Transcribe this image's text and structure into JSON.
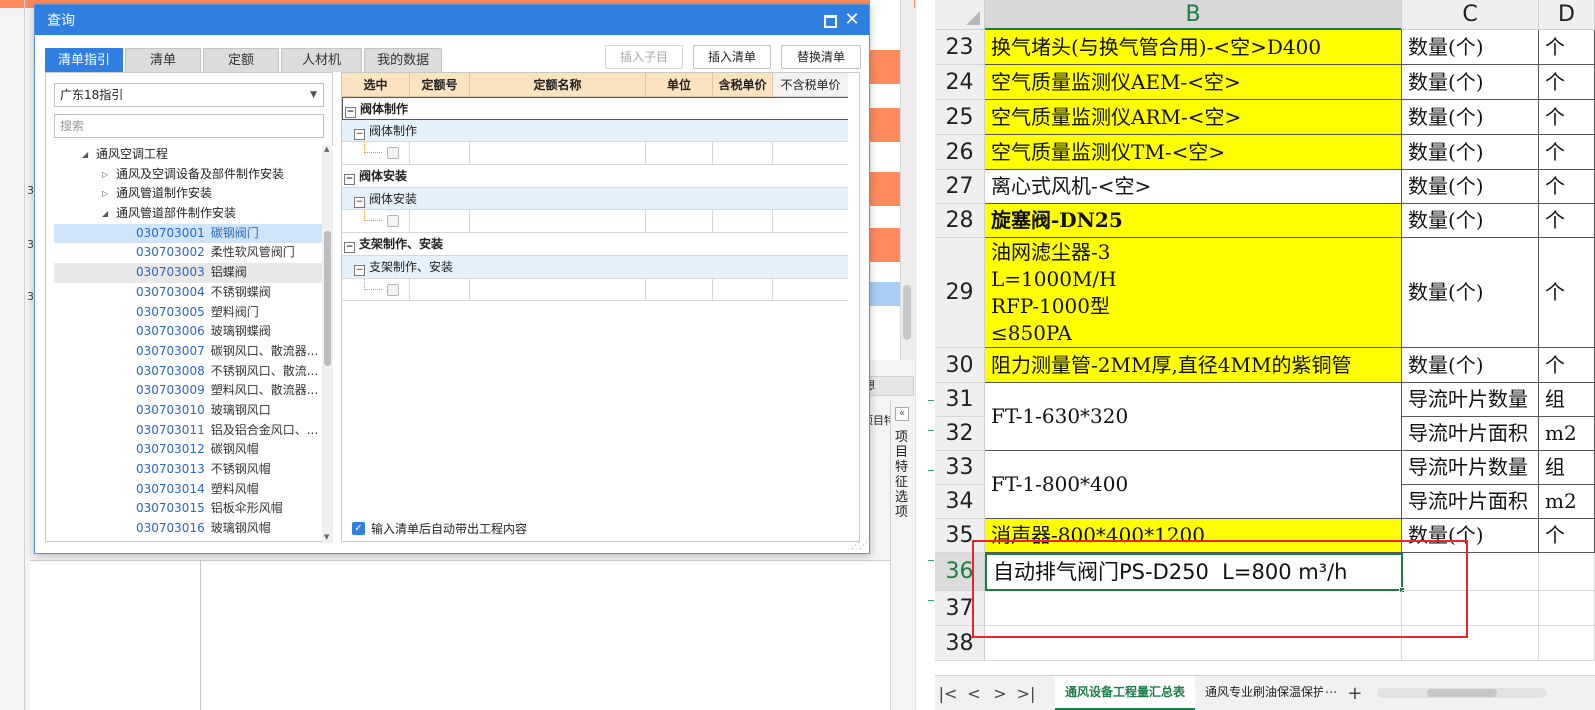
{
  "dialog": {
    "title": "查询",
    "tabs": [
      {
        "label": "清单指引",
        "active": true
      },
      {
        "label": "清单",
        "active": false
      },
      {
        "label": "定额",
        "active": false
      },
      {
        "label": "人材机",
        "active": false
      },
      {
        "label": "我的数据",
        "active": false
      }
    ],
    "buttons": {
      "insert_child": "插入子目",
      "insert_list": "插入清单(I)",
      "replace_list": "替换清单(R)"
    },
    "region_select": "广东18指引",
    "search_placeholder": "搜索",
    "tree": {
      "root": "通风空调工程",
      "groups": [
        "通风及空调设备及部件制作安装",
        "通风管道制作安装",
        "通风管道部件制作安装"
      ],
      "items": [
        {
          "code": "030703001",
          "name": "碳钢阀门"
        },
        {
          "code": "030703002",
          "name": "柔性软风管阀门"
        },
        {
          "code": "030703003",
          "name": "铝蝶阀"
        },
        {
          "code": "030703004",
          "name": "不锈钢蝶阀"
        },
        {
          "code": "030703005",
          "name": "塑料阀门"
        },
        {
          "code": "030703006",
          "name": "玻璃钢蝶阀"
        },
        {
          "code": "030703007",
          "name": "碳钢风口、散流器..."
        },
        {
          "code": "030703008",
          "name": "不锈钢风口、散流..."
        },
        {
          "code": "030703009",
          "name": "塑料风口、散流器..."
        },
        {
          "code": "030703010",
          "name": "玻璃钢风口"
        },
        {
          "code": "030703011",
          "name": "铝及铝合金风口、..."
        },
        {
          "code": "030703012",
          "name": "碳钢风帽"
        },
        {
          "code": "030703013",
          "name": "不锈钢风帽"
        },
        {
          "code": "030703014",
          "name": "塑料风帽"
        },
        {
          "code": "030703015",
          "name": "铝板伞形风帽"
        },
        {
          "code": "030703016",
          "name": "玻璃钢风帽"
        }
      ]
    },
    "grid": {
      "headers": [
        "选中",
        "定额号",
        "定额名称",
        "单位",
        "含税单价",
        "不含税单价"
      ],
      "groups": [
        {
          "name": "阀体制作",
          "sub": "阀体制作"
        },
        {
          "name": "阀体安装",
          "sub": "阀体安装"
        },
        {
          "name": "支架制作、安装",
          "sub": "支架制作、安装"
        }
      ]
    },
    "auto_bring_label": "输入清单后自动带出工程内容"
  },
  "background_app": {
    "side_panel_label": "项目特征选项",
    "tab_fragment": "想",
    "tab_fragment2": "项目特",
    "left_row_numbers": [
      "3",
      "3",
      "3"
    ]
  },
  "sheet": {
    "columns": [
      "B",
      "C",
      "D"
    ],
    "rows": [
      {
        "num": "23",
        "b": "换气堵头(与换气管合用)-<空>D400",
        "c": "数量(个)",
        "d": "个",
        "yellow": true
      },
      {
        "num": "24",
        "b": "空气质量监测仪AEM-<空>",
        "c": "数量(个)",
        "d": "个",
        "yellow": true
      },
      {
        "num": "25",
        "b": "空气质量监测仪ARM-<空>",
        "c": "数量(个)",
        "d": "个",
        "yellow": true
      },
      {
        "num": "26",
        "b": "空气质量监测仪TM-<空>",
        "c": "数量(个)",
        "d": "个",
        "yellow": true
      },
      {
        "num": "27",
        "b": "离心式风机-<空>",
        "c": "数量(个)",
        "d": "个",
        "yellow": false
      },
      {
        "num": "28",
        "b": "旋塞阀-DN25",
        "c": "数量(个)",
        "d": "个",
        "yellow": true
      },
      {
        "num": "29",
        "b": "油网滤尘器-3\nL=1000M/H\nRFP-1000型\n≤850PA",
        "c": "数量(个)",
        "d": "个",
        "yellow": true
      },
      {
        "num": "30",
        "b": "阻力测量管-2MM厚,直径4MM的紫铜管",
        "c": "数量(个)",
        "d": "个",
        "yellow": true
      },
      {
        "num": "31",
        "b": "FT-1-630*320",
        "c": "导流叶片数量",
        "d": "组",
        "yellow": false
      },
      {
        "num": "32",
        "b": "",
        "c": "导流叶片面积",
        "d": "m2",
        "yellow": false
      },
      {
        "num": "33",
        "b": "FT-1-800*400",
        "c": "导流叶片数量",
        "d": "组",
        "yellow": false
      },
      {
        "num": "34",
        "b": "",
        "c": "导流叶片面积",
        "d": "m2",
        "yellow": false
      },
      {
        "num": "35",
        "b": "消声器-800*400*1200",
        "c": "数量(个)",
        "d": "个",
        "yellow": true
      },
      {
        "num": "36",
        "b": "自动排气阀门PS-D250  L=800 m³/h",
        "c": "",
        "d": "",
        "yellow": false
      },
      {
        "num": "37",
        "b": "",
        "c": "",
        "d": "",
        "yellow": false
      },
      {
        "num": "38",
        "b": "",
        "c": "",
        "d": "",
        "yellow": false
      }
    ],
    "tabs": [
      "通风设备工程量汇总表",
      "通风专业刷油保温保护"
    ],
    "more": "···",
    "add": "+"
  },
  "colors": {
    "accent": "#2f7fe0",
    "highlight_yellow": "#ffff00",
    "excel_green": "#1b7e47",
    "annotation_red": "#e8262a",
    "orange": "#ff8a5e"
  }
}
